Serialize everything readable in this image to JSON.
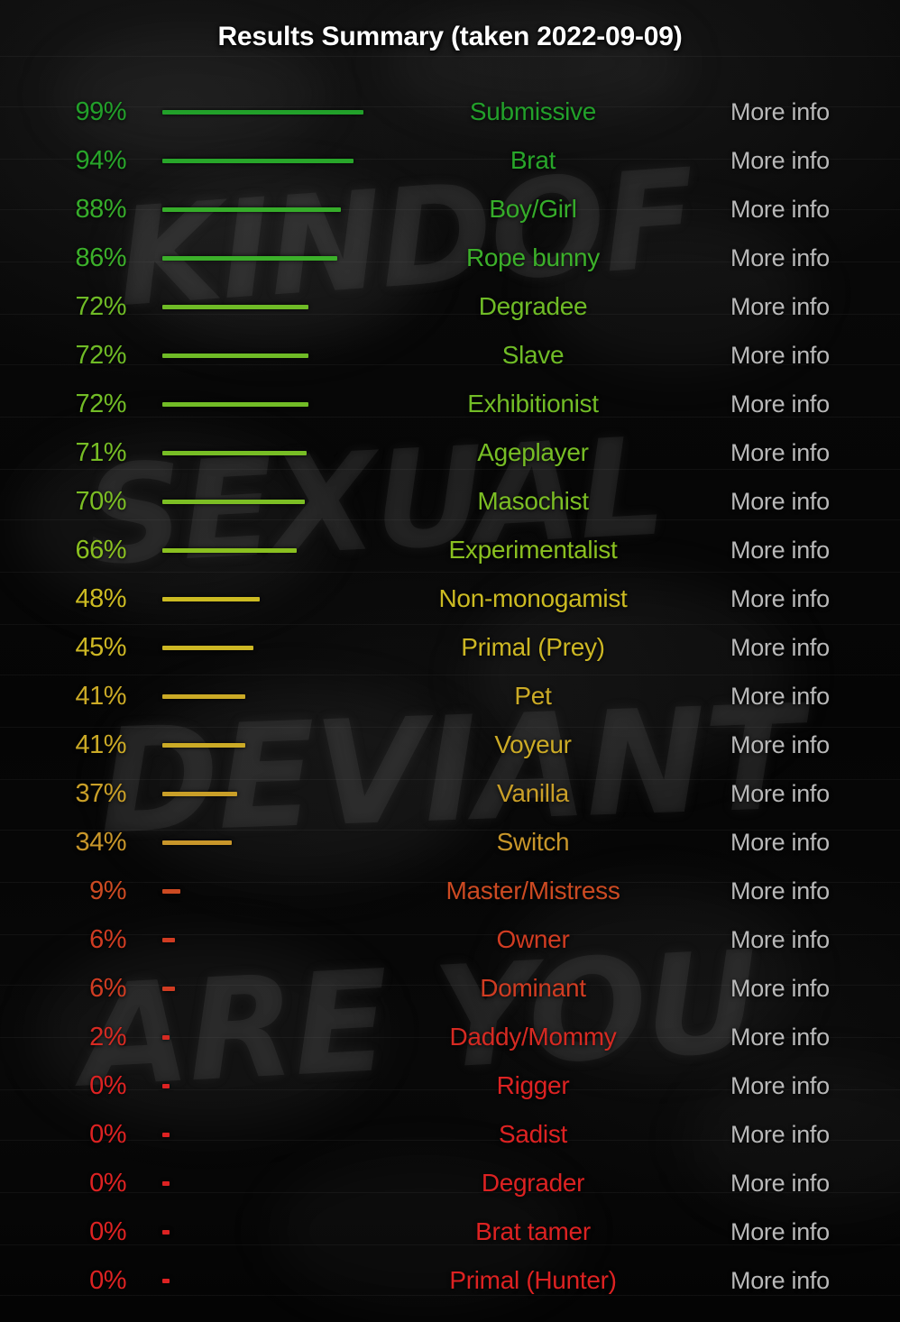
{
  "header": {
    "title": "Results Summary (taken 2022-09-09)"
  },
  "more_info_label": "More info",
  "colors": {
    "title": "#ffffff",
    "more_info": "#b9b9b9",
    "green": "#2eaa2e",
    "yellow_green": "#8ac020",
    "yellow": "#ccbb22",
    "orange": "#c8962a",
    "red": "#d23a22",
    "background": "#050505"
  },
  "background_graffiti": [
    "KINDOF",
    "SEXUAL",
    "DEVIANT",
    "ARE YOU"
  ],
  "chart_data": {
    "type": "bar",
    "title": "Results Summary (taken 2022-09-09)",
    "xlabel": "",
    "ylabel": "",
    "xlim": [
      0,
      100
    ],
    "grid": false,
    "orientation": "horizontal",
    "legend": "none",
    "value_suffix": "%",
    "categories": [
      "Submissive",
      "Brat",
      "Boy/Girl",
      "Rope bunny",
      "Degradee",
      "Slave",
      "Exhibitionist",
      "Ageplayer",
      "Masochist",
      "Experimentalist",
      "Non-monogamist",
      "Primal (Prey)",
      "Pet",
      "Voyeur",
      "Vanilla",
      "Switch",
      "Master/Mistress",
      "Owner",
      "Dominant",
      "Daddy/Mommy",
      "Rigger",
      "Sadist",
      "Degrader",
      "Brat tamer",
      "Primal (Hunter)"
    ],
    "values": [
      99,
      94,
      88,
      86,
      72,
      72,
      72,
      71,
      70,
      66,
      48,
      45,
      41,
      41,
      37,
      34,
      9,
      6,
      6,
      2,
      0,
      0,
      0,
      0,
      0
    ]
  },
  "rows": [
    {
      "percent": "99%",
      "label": "Submissive",
      "value": 99,
      "color": "#22a02a"
    },
    {
      "percent": "94%",
      "label": "Brat",
      "value": 94,
      "color": "#28a62a"
    },
    {
      "percent": "88%",
      "label": "Boy/Girl",
      "value": 88,
      "color": "#36ad2a"
    },
    {
      "percent": "86%",
      "label": "Rope bunny",
      "value": 86,
      "color": "#3cb02a"
    },
    {
      "percent": "72%",
      "label": "Degradee",
      "value": 72,
      "color": "#6fbb26"
    },
    {
      "percent": "72%",
      "label": "Slave",
      "value": 72,
      "color": "#6fbb26"
    },
    {
      "percent": "72%",
      "label": "Exhibitionist",
      "value": 72,
      "color": "#72bc26"
    },
    {
      "percent": "71%",
      "label": "Ageplayer",
      "value": 71,
      "color": "#77bd25"
    },
    {
      "percent": "70%",
      "label": "Masochist",
      "value": 70,
      "color": "#7cbe24"
    },
    {
      "percent": "66%",
      "label": "Experimentalist",
      "value": 66,
      "color": "#8ac020"
    },
    {
      "percent": "48%",
      "label": "Non-monogamist",
      "value": 48,
      "color": "#ccbb22"
    },
    {
      "percent": "45%",
      "label": "Primal (Prey)",
      "value": 45,
      "color": "#cdb724"
    },
    {
      "percent": "41%",
      "label": "Pet",
      "value": 41,
      "color": "#cbaa26"
    },
    {
      "percent": "41%",
      "label": "Voyeur",
      "value": 41,
      "color": "#cbaa26"
    },
    {
      "percent": "37%",
      "label": "Vanilla",
      "value": 37,
      "color": "#c99f28"
    },
    {
      "percent": "34%",
      "label": "Switch",
      "value": 34,
      "color": "#c8962a"
    },
    {
      "percent": "9%",
      "label": "Master/Mistress",
      "value": 9,
      "color": "#cc4a22"
    },
    {
      "percent": "6%",
      "label": "Owner",
      "value": 6,
      "color": "#d03c22"
    },
    {
      "percent": "6%",
      "label": "Dominant",
      "value": 6,
      "color": "#d03c22"
    },
    {
      "percent": "2%",
      "label": "Daddy/Mommy",
      "value": 2,
      "color": "#d62a22"
    },
    {
      "percent": "0%",
      "label": "Rigger",
      "value": 0,
      "color": "#dd2222"
    },
    {
      "percent": "0%",
      "label": "Sadist",
      "value": 0,
      "color": "#dd2222"
    },
    {
      "percent": "0%",
      "label": "Degrader",
      "value": 0,
      "color": "#dd2222"
    },
    {
      "percent": "0%",
      "label": "Brat tamer",
      "value": 0,
      "color": "#dd2222"
    },
    {
      "percent": "0%",
      "label": "Primal (Hunter)",
      "value": 0,
      "color": "#dd2222"
    }
  ]
}
